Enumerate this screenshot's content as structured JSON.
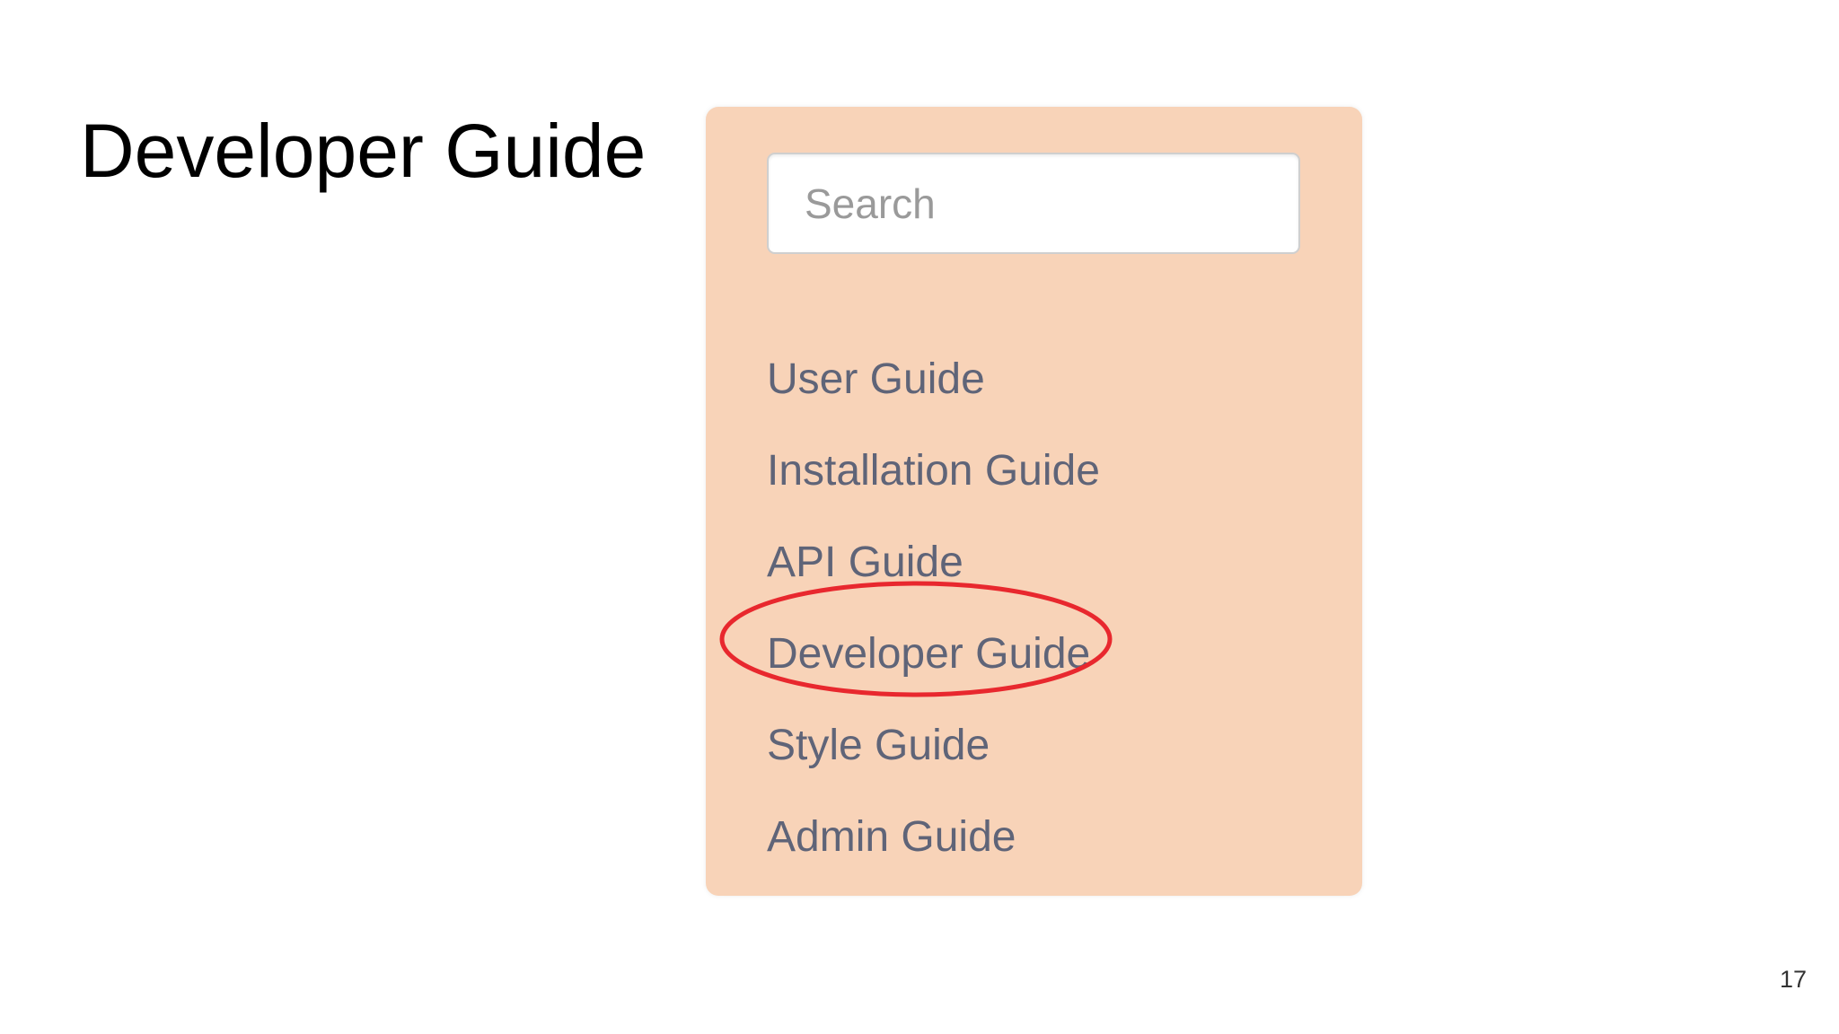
{
  "slide": {
    "title": "Developer Guide",
    "page_number": "17"
  },
  "nav_panel": {
    "background_color": "#f8d3b8",
    "search": {
      "placeholder": "Search",
      "value": ""
    },
    "items": [
      {
        "label": "User Guide"
      },
      {
        "label": "Installation Guide"
      },
      {
        "label": "API Guide"
      },
      {
        "label": "Developer Guide",
        "highlighted": true
      },
      {
        "label": "Style Guide"
      },
      {
        "label": "Admin Guide"
      }
    ]
  },
  "annotation": {
    "type": "ellipse",
    "color": "#e8282e",
    "target": "Developer Guide"
  }
}
